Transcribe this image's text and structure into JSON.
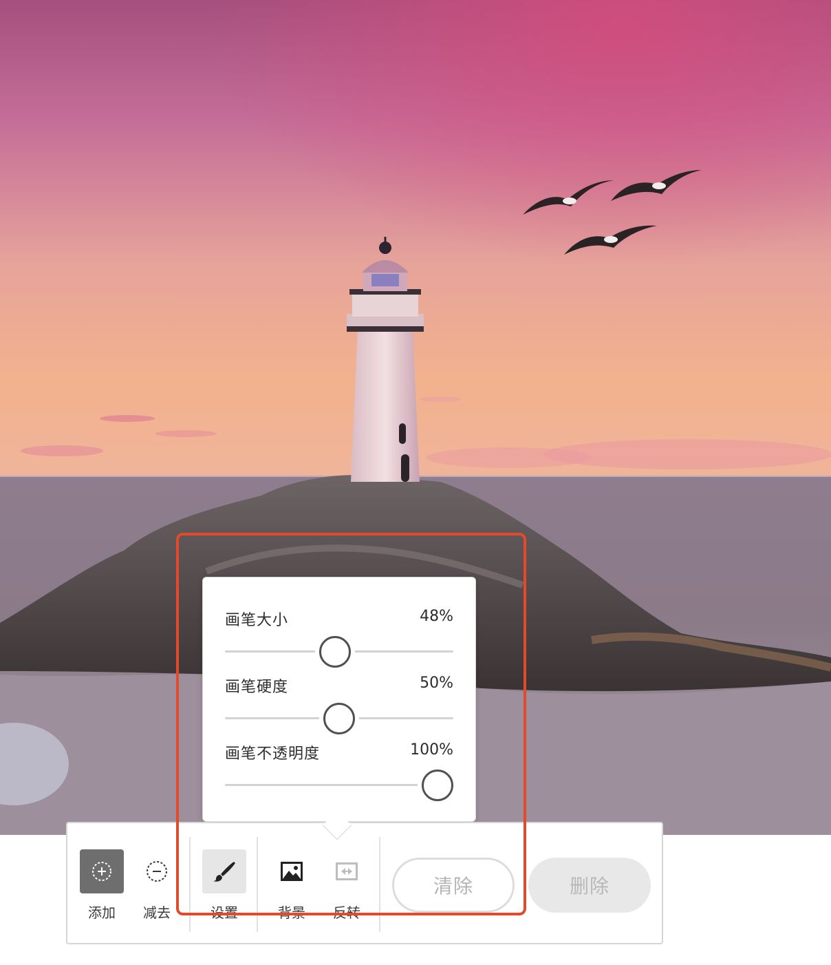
{
  "canvas": {
    "image": "lighthouse-sunset-photo"
  },
  "brush_settings": {
    "sliders": [
      {
        "label": "画笔大小",
        "value_text": "48%",
        "value": 48
      },
      {
        "label": "画笔硬度",
        "value_text": "50%",
        "value": 50
      },
      {
        "label": "画笔不透明度",
        "value_text": "100%",
        "value": 100
      }
    ]
  },
  "toolbar": {
    "add_label": "添加",
    "subtract_label": "减去",
    "settings_label": "设置",
    "background_label": "背景",
    "invert_label": "反转",
    "clear_label": "清除",
    "delete_label": "删除"
  },
  "icons": {
    "add": "add-circle-icon",
    "subtract": "subtract-circle-icon",
    "settings": "brush-icon",
    "background": "image-icon",
    "invert": "invert-icon"
  },
  "colors": {
    "highlight": "#e24a2c",
    "active_tool": "#6e6e6e",
    "selected_tool": "#e6e6e6"
  }
}
